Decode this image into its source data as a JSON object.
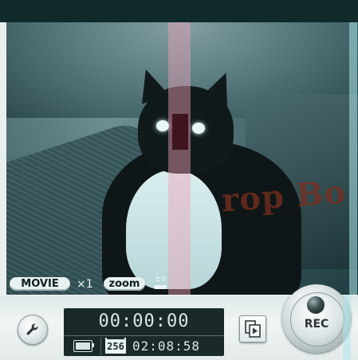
{
  "status_bar": {
    "mode_label": "MOVIE",
    "zoom_factor": "×1",
    "zoom_label": "zoom",
    "exposure_value": "±0"
  },
  "viewfinder": {
    "watermark_text": "rop Bo"
  },
  "controls": {
    "elapsed_time": "00:00:00",
    "quality_badge": "256",
    "remaining_time": "02:08:58",
    "rec_label": "REC"
  },
  "icons": {
    "settings": "wrench-icon",
    "battery": "battery-icon",
    "playback": "playback-icon",
    "rec_lens": "lens-icon"
  },
  "colors": {
    "panel": "#e3eaea",
    "counter_background": "#1a2a2b",
    "counter_text": "#dbe8e8",
    "top_strip": "#102a2a"
  }
}
